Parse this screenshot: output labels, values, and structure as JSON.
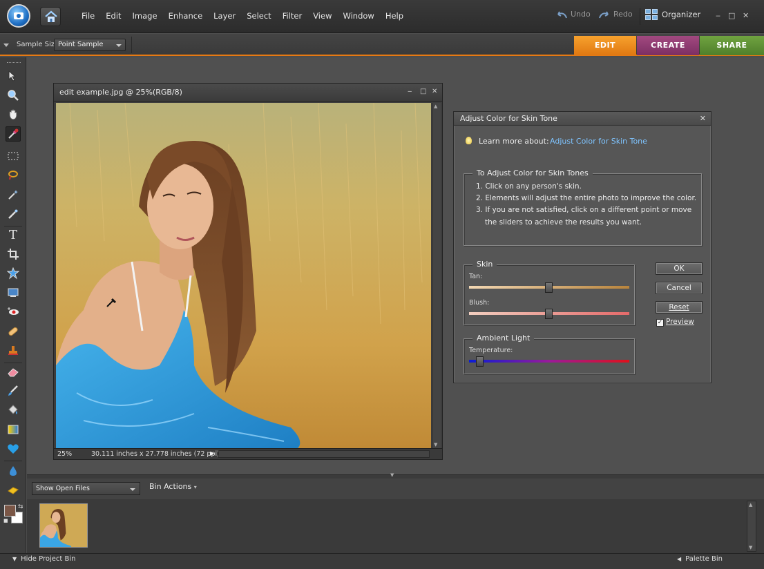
{
  "menubar": {
    "menus": [
      "File",
      "Edit",
      "Image",
      "Enhance",
      "Layer",
      "Select",
      "Filter",
      "View",
      "Window",
      "Help"
    ],
    "undo": "Undo",
    "redo": "Redo",
    "organizer": "Organizer"
  },
  "options": {
    "sample_size_label": "Sample Size:",
    "sample_size_value": "Point Sample"
  },
  "mode_tabs": {
    "edit": "EDIT",
    "create": "CREATE",
    "share": "SHARE"
  },
  "colors": {
    "edit": "#e98414",
    "create": "#91407a",
    "share": "#5f9236",
    "accent_border": "#e77a13",
    "foreground_swatch": "#7a5646",
    "background_swatch": "#ffffff",
    "link": "#7fc4ff"
  },
  "document": {
    "title": "edit example.jpg @ 25%(RGB/8)",
    "zoom": "25%",
    "size": "30.111 inches x 27.778 inches (72 ppi)"
  },
  "dialog": {
    "title": "Adjust Color for Skin Tone",
    "learn_label": "Learn more about:",
    "learn_link": "Adjust Color for Skin Tone",
    "instructions_legend": "To Adjust Color for Skin Tones",
    "steps": [
      "1. Click on any person's skin.",
      "2. Elements will adjust the entire photo to improve the color.",
      "3. If you are not satisfied, click on a different point or move",
      "the sliders to achieve the results you want."
    ],
    "skin_legend": "Skin",
    "tan_label": "Tan:",
    "tan_value": 0.5,
    "blush_label": "Blush:",
    "blush_value": 0.5,
    "ambient_legend": "Ambient Light",
    "temperature_label": "Temperature:",
    "temperature_value": 0.07,
    "ok": "OK",
    "cancel": "Cancel",
    "reset": "Reset",
    "preview": "Preview",
    "preview_checked": true
  },
  "bin": {
    "show_label": "Show Open Files",
    "actions": "Bin Actions"
  },
  "status": {
    "hide_bin": "Hide Project Bin",
    "palette_bin": "Palette Bin"
  }
}
